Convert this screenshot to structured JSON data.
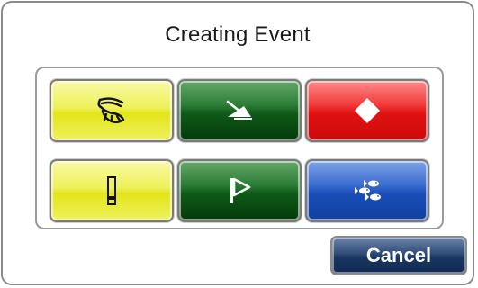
{
  "dialog": {
    "title": "Creating Event",
    "cancel_label": "Cancel"
  },
  "event_buttons": [
    {
      "icon": "shrimp-icon",
      "color": "#e8ea2a"
    },
    {
      "icon": "triangle-point-icon",
      "color": "#1c6a26"
    },
    {
      "icon": "diamond-icon",
      "color": "#e61a1a"
    },
    {
      "icon": "exclamation-icon",
      "color": "#e8ea2a"
    },
    {
      "icon": "flag-icon",
      "color": "#1c6a26"
    },
    {
      "icon": "fish-school-icon",
      "color": "#1f55bf"
    }
  ]
}
